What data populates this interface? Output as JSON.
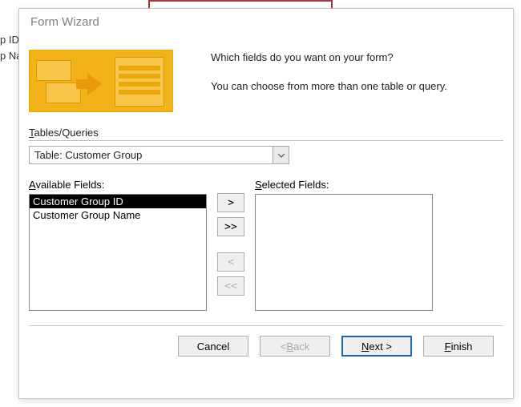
{
  "background": {
    "left_text_1": "p ID",
    "left_text_2": "p Na"
  },
  "dialog": {
    "title": "Form Wizard",
    "intro_line1": "Which fields do you want on your form?",
    "intro_line2": "You can choose from more than one table or query.",
    "tables_label_pre": "T",
    "tables_label_post": "ables/Queries",
    "combo_value": "Table: Customer Group",
    "available_pre": "A",
    "available_post": "vailable Fields:",
    "selected_pre": "S",
    "selected_post": "elected Fields:",
    "available_fields": [
      {
        "label": "Customer Group ID",
        "selected": true
      },
      {
        "label": "Customer Group Name",
        "selected": false
      }
    ],
    "selected_fields": [],
    "move": {
      "add": ">",
      "add_all": ">>",
      "remove": "<",
      "remove_all": "<<"
    },
    "buttons": {
      "cancel": "Cancel",
      "back_lt": "< ",
      "back_pre": "B",
      "back_post": "ack",
      "next_pre": "N",
      "next_post": "ext >",
      "finish_pre": "F",
      "finish_post": "inish"
    }
  }
}
